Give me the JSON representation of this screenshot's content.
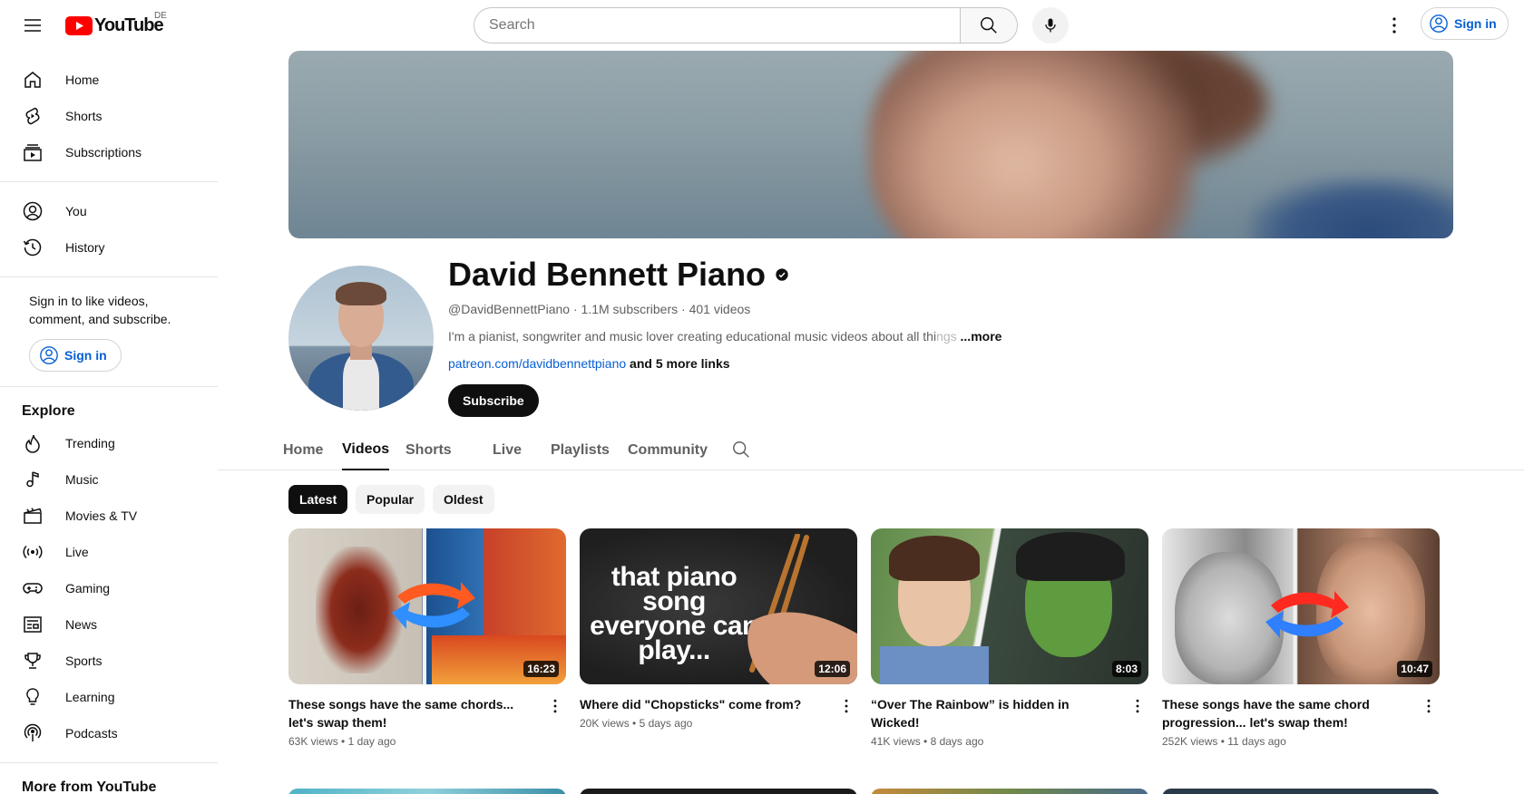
{
  "header": {
    "logo_text": "YouTube",
    "country_code": "DE",
    "search_placeholder": "Search",
    "signin_label": "Sign in"
  },
  "sidebar": {
    "main": [
      {
        "label": "Home",
        "icon": "home-icon"
      },
      {
        "label": "Shorts",
        "icon": "shorts-icon"
      },
      {
        "label": "Subscriptions",
        "icon": "subscriptions-icon"
      }
    ],
    "you": [
      {
        "label": "You",
        "icon": "you-icon"
      },
      {
        "label": "History",
        "icon": "history-icon"
      }
    ],
    "signin_text": "Sign in to like videos, comment, and subscribe.",
    "signin_label": "Sign in",
    "explore_title": "Explore",
    "explore": [
      {
        "label": "Trending",
        "icon": "trending-icon"
      },
      {
        "label": "Music",
        "icon": "music-icon"
      },
      {
        "label": "Movies & TV",
        "icon": "movies-icon"
      },
      {
        "label": "Live",
        "icon": "live-icon"
      },
      {
        "label": "Gaming",
        "icon": "gaming-icon"
      },
      {
        "label": "News",
        "icon": "news-icon"
      },
      {
        "label": "Sports",
        "icon": "sports-icon"
      },
      {
        "label": "Learning",
        "icon": "learning-icon"
      },
      {
        "label": "Podcasts",
        "icon": "podcasts-icon"
      }
    ],
    "more_title": "More from YouTube"
  },
  "channel": {
    "name": "David Bennett Piano",
    "handle": "@DavidBennettPiano",
    "subscribers": "1.1M subscribers",
    "videos": "401 videos",
    "description": "I'm a pianist, songwriter and music lover creating educational music videos about all thi",
    "description_fade": "ngs",
    "more_label": "...more",
    "link": "patreon.com/davidbennettpiano",
    "more_links": "and 5 more links",
    "subscribe_label": "Subscribe"
  },
  "tabs": [
    "Home",
    "Videos",
    "Shorts",
    "Live",
    "Playlists",
    "Community"
  ],
  "active_tab": "Videos",
  "chips": [
    "Latest",
    "Popular",
    "Oldest"
  ],
  "active_chip": "Latest",
  "videos": [
    {
      "title": "These songs have the same chords... let's swap them!",
      "views": "63K views",
      "age": "1 day ago",
      "duration": "16:23"
    },
    {
      "title": "Where did \"Chopsticks\" come from?",
      "views": "20K views",
      "age": "5 days ago",
      "duration": "12:06",
      "thumb_text": "that piano song everyone can play..."
    },
    {
      "title": "“Over The Rainbow” is hidden in Wicked!",
      "views": "41K views",
      "age": "8 days ago",
      "duration": "8:03"
    },
    {
      "title": "These songs have the same chord progression... let's swap them!",
      "views": "252K views",
      "age": "11 days ago",
      "duration": "10:47"
    }
  ],
  "colors": {
    "accent_link": "#065fd4",
    "brand_red": "#ff0000",
    "text_primary": "#0f0f0f",
    "text_secondary": "#606060"
  }
}
